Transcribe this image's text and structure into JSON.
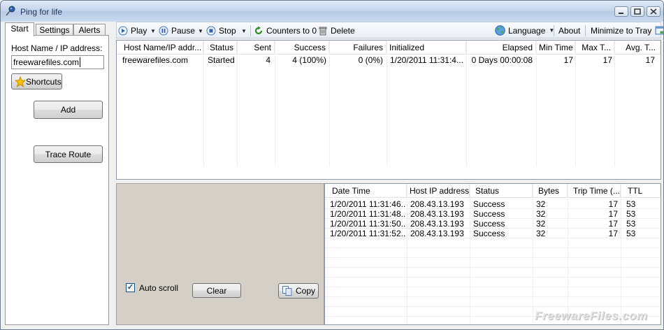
{
  "window": {
    "title": "Ping for life"
  },
  "tabs": [
    {
      "label": "Start",
      "active": true
    },
    {
      "label": "Settings",
      "active": false
    },
    {
      "label": "Alerts",
      "active": false
    }
  ],
  "start_panel": {
    "host_label": "Host Name / IP address:",
    "host_value": "freewarefiles.com",
    "shortcuts_label": "Shortcuts",
    "add_label": "Add",
    "trace_route_label": "Trace Route"
  },
  "toolbar": {
    "play_label": "Play",
    "pause_label": "Pause",
    "stop_label": "Stop",
    "counters_label": "Counters to 0",
    "delete_label": "Delete",
    "language_label": "Language",
    "about_label": "About",
    "minimize_label": "Minimize to Tray"
  },
  "hosts_table": {
    "columns": [
      "Host Name/IP addr...",
      "Status",
      "Sent",
      "Success",
      "Failures",
      "Initialized",
      "Elapsed",
      "Min Time",
      "Max T...",
      "Avg. T..."
    ],
    "rows": [
      [
        "freewarefiles.com",
        "Started",
        "4",
        "4 (100%)",
        "0 (0%)",
        "1/20/2011 11:31:4...",
        "0 Days 00:00:08",
        "17",
        "17",
        "17"
      ]
    ]
  },
  "log_panel": {
    "auto_scroll_label": "Auto scroll",
    "auto_scroll_checked": true,
    "clear_label": "Clear",
    "copy_label": "Copy"
  },
  "log_table": {
    "columns": [
      "Date Time",
      "Host IP address",
      "Status",
      "Bytes",
      "Trip Time (...",
      "TTL"
    ],
    "rows": [
      [
        "1/20/2011 11:31:46...",
        "208.43.13.193",
        "Success",
        "32",
        "17",
        "53"
      ],
      [
        "1/20/2011 11:31:48...",
        "208.43.13.193",
        "Success",
        "32",
        "17",
        "53"
      ],
      [
        "1/20/2011 11:31:50...",
        "208.43.13.193",
        "Success",
        "32",
        "17",
        "53"
      ],
      [
        "1/20/2011 11:31:52...",
        "208.43.13.193",
        "Success",
        "32",
        "17",
        "53"
      ]
    ]
  },
  "watermark": "FreewareFiles.com",
  "icons": {
    "app": "pin-icon",
    "play": "play-icon",
    "pause": "pause-icon",
    "stop": "stop-icon",
    "counters": "reset-icon",
    "delete": "trash-icon",
    "language": "globe-icon",
    "minimize": "tray-icon",
    "shortcuts": "star-icon",
    "copy": "copy-icon"
  },
  "colors": {
    "accent": "#3a6ea5",
    "titlebar": "#c2d4ea",
    "panel": "#d4d0c8"
  }
}
